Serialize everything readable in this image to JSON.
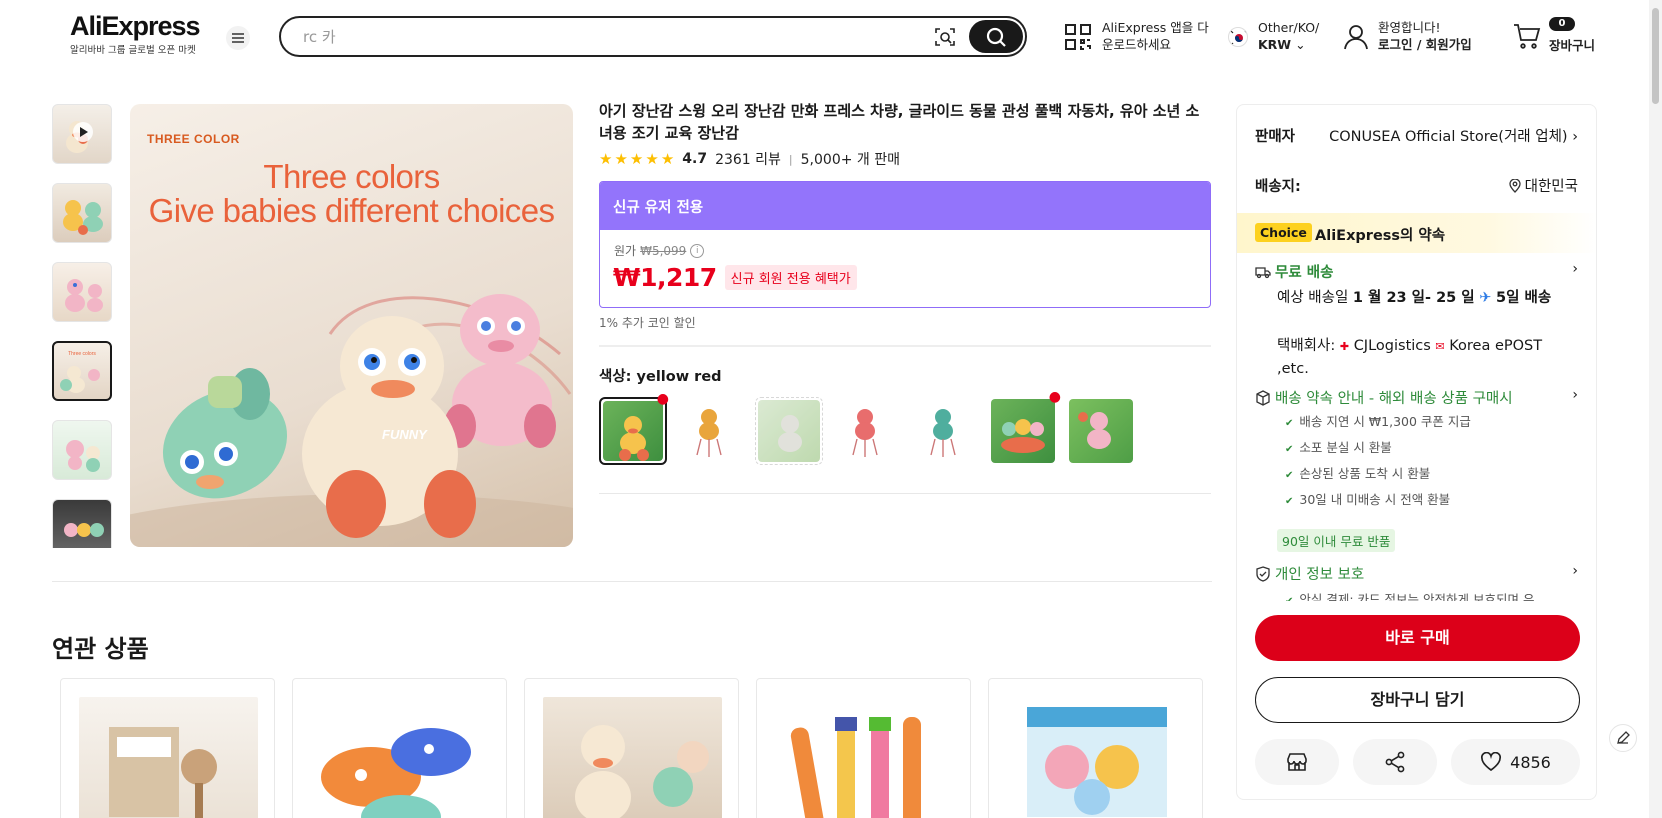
{
  "header": {
    "logo": "AliExpress",
    "logo_sub": "알리바바 그룹 글로벌 오픈 마켓",
    "search_placeholder": "rc 카",
    "app_line1": "AliExpress 앱을 다",
    "app_line2": "운로드하세요",
    "locale_line1": "Other/KO/",
    "locale_line2": "KRW",
    "user_line1": "환영합니다!",
    "user_line2": "로그인 / 회원가입",
    "cart_count": "0",
    "cart_label": "장바구니"
  },
  "gallery": {
    "badge": "THREE COLOR",
    "headline1": "Three colors",
    "headline2": "Give babies different choices",
    "toy_text": "FUNNY"
  },
  "product": {
    "title": "아기 장난감 스윙 오리 장난감 만화 프레스 차량, 글라이드 동물 관성 풀백 자동차, 유아 소년 소녀용 조기 교육 장난감",
    "rating": "4.7",
    "reviews": "2361 리뷰",
    "sold": "5,000+ 개 판매",
    "stars": 5,
    "promo_head": "신규 유저 전용",
    "orig_label": "원가",
    "orig_price": "₩5,099",
    "price": "₩1,217",
    "price_tag": "신규 회원 전용 혜택가",
    "coin": "1% 추가 코인 할인",
    "color_label": "색상:",
    "color_value": "yellow red"
  },
  "related": {
    "title": "연관 상품"
  },
  "panel": {
    "seller_label": "판매자",
    "seller_value": "CONUSEA Official Store(거래 업체)",
    "ship_label": "배송지:",
    "ship_value": "대한민국",
    "choice_badge": "Choice",
    "choice_text": "AliExpress의 약속",
    "free_ship": "무료 배송",
    "eta_prefix": "예상 배송일",
    "eta_dates": "1 월 23 일- 25 일",
    "eta_days": "5일 배송",
    "carrier_prefix": "택배회사:",
    "carrier1": "CJLogistics",
    "carrier2": "Korea ePOST ,etc.",
    "promise_title": "배송 약속 안내 - 해외 배송 상품 구매시",
    "promises": [
      "배송 지연 시 ₩1,300 쿠폰 지급",
      "소포 분실 시 환불",
      "손상된 상품 도착 시 환불",
      "30일 내 미배송 시 전액 환불"
    ],
    "return_tag": "90일 이내 무료 반품",
    "privacy_title": "개인 정보 보호",
    "privacy_line": "안심 결제: 카드 정보는 안전하게 보호되며 유",
    "buy_now": "바로 구매",
    "add_cart": "장바구니 담기",
    "wish_count": "4856"
  },
  "colors": {
    "accent": "#dc0019",
    "promo": "#9374fb",
    "green": "#2e8b3a",
    "star": "#fdbf02"
  }
}
